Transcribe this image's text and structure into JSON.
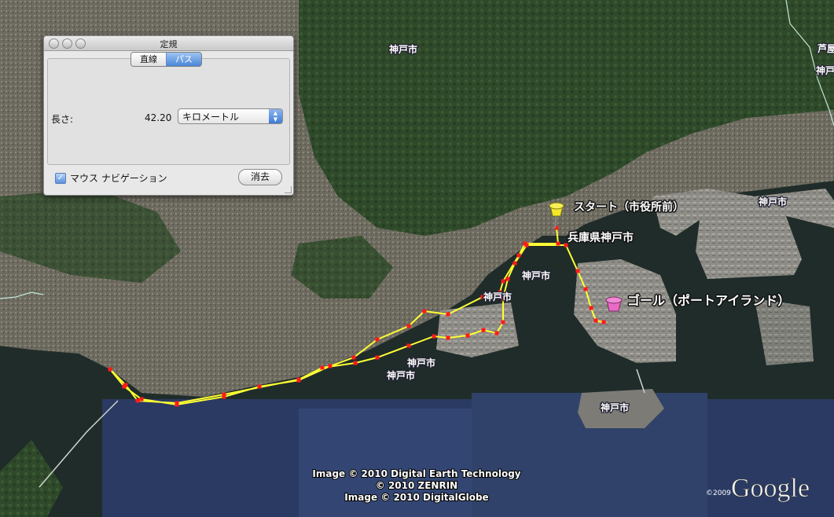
{
  "panel": {
    "title": "定規",
    "tabs": [
      {
        "label": "直線",
        "active": false
      },
      {
        "label": "パス",
        "active": true
      }
    ],
    "length_label": "長さ:",
    "length_value": "42.20",
    "unit_selected": "キロメートル",
    "mouse_nav_label": "マウス ナビゲーション",
    "mouse_nav_checked": true,
    "clear_label": "消去"
  },
  "map": {
    "city_labels": [
      "神戸市",
      "神戸市",
      "神戸市",
      "神戸市",
      "神戸市",
      "神戸市",
      "神戸市",
      "神戸市"
    ],
    "corner_label": "芦屋",
    "area_label": "兵庫県神戸市",
    "start_label": "スタート（市役所前）",
    "goal_label": "ゴール（ポートアイランド）",
    "credits": [
      "Image © 2010 Digital Earth Technology",
      "© 2010 ZENRIN",
      "Image © 2010 DigitalGlobe"
    ],
    "copyright_year": "©2009",
    "logo": "Google",
    "start_pin_color": "#f3e82a",
    "goal_pin_color": "#e86bc5",
    "path_color": "#ffff33",
    "point_color": "#ff1a1a"
  }
}
